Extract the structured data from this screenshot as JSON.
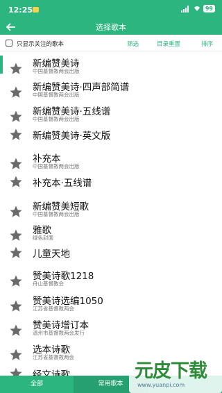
{
  "status": {
    "time": "12:25",
    "battery": "99"
  },
  "app_bar": {
    "title": "选择歌本"
  },
  "toolbar": {
    "only_followed_label": "只显示关注的歌本",
    "filter_label": "筛选",
    "reset_label": "目录重置",
    "sort_label": "排序"
  },
  "songbooks": [
    {
      "title": "新编赞美诗",
      "subtitle": "中国基督教两会出版"
    },
    {
      "title": "新编赞美诗·四声部简谱",
      "subtitle": "中国基督教两会出版"
    },
    {
      "title": "新编赞美诗·五线谱",
      "subtitle": "中国基督教两会出版"
    },
    {
      "title": "新编赞美诗·英文版",
      "subtitle": ""
    },
    {
      "title": "补充本",
      "subtitle": "中国基督教两会出版"
    },
    {
      "title": "补充本·五线谱",
      "subtitle": ""
    },
    {
      "title": "新编赞美短歌",
      "subtitle": "中国基督教两会出版"
    },
    {
      "title": "雅歌",
      "subtitle": "绿色封面"
    },
    {
      "title": "儿童天地",
      "subtitle": ""
    },
    {
      "title": "赞美诗歌1218",
      "subtitle": "舟山基督教会"
    },
    {
      "title": "赞美诗选编1050",
      "subtitle": "江苏省基督教两会"
    },
    {
      "title": "赞美诗增订本",
      "subtitle": "温州市基督教两会发行"
    },
    {
      "title": "选本诗歌",
      "subtitle": "江苏省基督教两会"
    },
    {
      "title": "经文诗歌",
      "subtitle": ""
    }
  ],
  "bottom_tabs": {
    "all_label": "全部",
    "common_label": "常用歌本"
  },
  "watermark": {
    "logo": "元皮下载",
    "url": "www.yuanpi.com"
  },
  "colors": {
    "accent": "#2db57f",
    "star": "#6b6b6b"
  }
}
